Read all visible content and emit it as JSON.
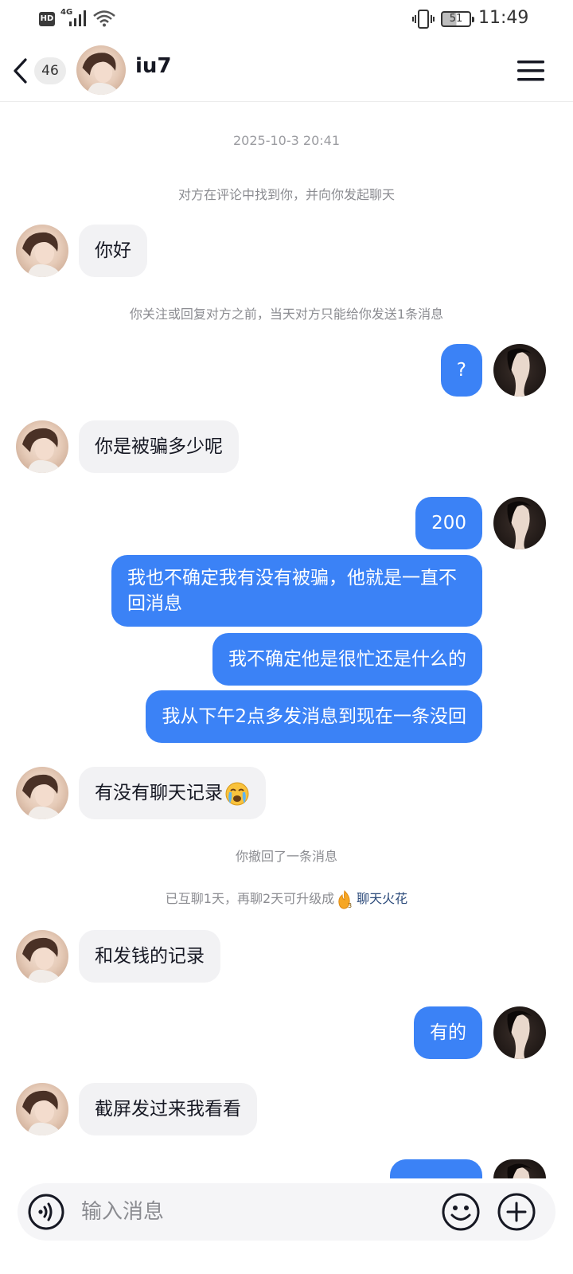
{
  "status_bar": {
    "hd_label": "HD",
    "network_label": "4G",
    "battery_level": "51",
    "time": "11:49"
  },
  "header": {
    "unread_count": "46",
    "contact_name": "iu7"
  },
  "chat": {
    "timestamp": "2025-10-3 20:41",
    "system_found": "对方在评论中找到你，并向你发起聊天",
    "system_limit": "你关注或回复对方之前，当天对方只能给你发送1条消息",
    "system_recalled": "你撤回了一条消息",
    "system_spark_prefix": "已互聊1天，再聊2天可升级成",
    "system_spark_link": "聊天火花",
    "msg_1": "你好",
    "msg_2": "?",
    "msg_3": "你是被骗多少呢",
    "msg_4": "200",
    "msg_5": "我也不确定我有没有被骗，他就是一直不回消息",
    "msg_6": "我不确定他是很忙还是什么的",
    "msg_7": "我从下午2点多发消息到现在一条没回",
    "msg_8": "有没有聊天记录",
    "msg_9": "和发钱的记录",
    "msg_10": "有的",
    "msg_11": "截屏发过来我看看"
  },
  "input": {
    "placeholder": "输入消息"
  },
  "colors": {
    "sent_bubble": "#3b82f6",
    "received_bubble": "#f2f2f4",
    "link": "#2b4a7a"
  }
}
